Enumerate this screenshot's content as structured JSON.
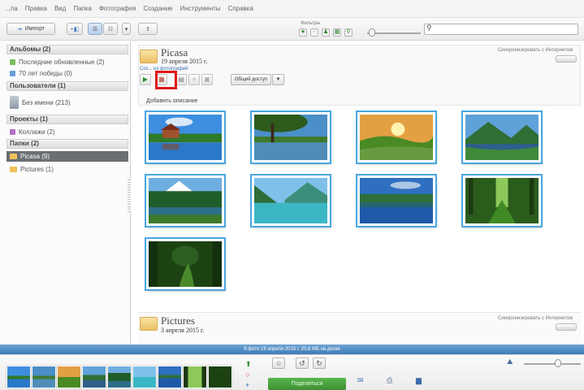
{
  "menu": [
    "...ла",
    "Правка",
    "Вид",
    "Папка",
    "Фотография",
    "Создание",
    "Инструменты",
    "Справка"
  ],
  "toolbar": {
    "import_label": "Импорт",
    "filters_label": "Фильтры"
  },
  "sidebar": {
    "albums": {
      "header": "Альбомы (2)",
      "items": [
        "Последние обновленные (2)",
        "70 лет победы (0)"
      ]
    },
    "users": {
      "header": "Пользователи (1)",
      "items": [
        "Без имени (213)"
      ]
    },
    "projects": {
      "header": "Проекты (1)",
      "items": [
        "Коллажи (2)"
      ]
    },
    "folders": {
      "header": "Папки (2)",
      "items": [
        "Picasa (9)",
        "Pictures (1)"
      ]
    }
  },
  "album": {
    "title": "Picasa",
    "date": "19 апреля 2015 г.",
    "link": "Соз... из фотографий",
    "sync_label": "Синхронизировать с Интернетом",
    "share_label": "Общий доступ",
    "add_description": "Добавить описание"
  },
  "pictures_album": {
    "title": "Pictures",
    "date": "3 апреля 2015 г.",
    "sync_label": "Синхронизировать с Интернетом"
  },
  "status": "9 фото   19 апреля 2015 г.   20,8 МБ на диске",
  "tray": {
    "share_button": "Поделиться"
  },
  "colors": {
    "selection": "#6a6f74",
    "thumb_border": "#49a6e0",
    "highlight": "#e01818",
    "status_bar": "#4a86bf",
    "share_green": "#4aa63f"
  },
  "photos": [
    {
      "name": "house-by-lake",
      "sky": "#3d8ee0",
      "ground": "#2f7a2a",
      "water": "#2a78c9"
    },
    {
      "name": "tree-over-lake",
      "sky": "#4a8fc7",
      "ground": "#3f7a2c",
      "water": "#4f8db8"
    },
    {
      "name": "golden-hills",
      "sky": "#e3a043",
      "ground": "#4a8a24",
      "water": "#6a9a40"
    },
    {
      "name": "mountain-lake",
      "sky": "#5fa1d9",
      "ground": "#2f6e35",
      "water": "#2e5f8a"
    },
    {
      "name": "snow-peak-forest",
      "sky": "#6faee0",
      "ground": "#1f5e2a",
      "water": "#2c6d8a"
    },
    {
      "name": "turquoise-lake",
      "sky": "#7ec0e8",
      "ground": "#3b8f7a",
      "water": "#3bb6c4"
    },
    {
      "name": "blue-lake-reflection",
      "sky": "#2f6fbf",
      "ground": "#2e6f3a",
      "water": "#1e5aa8"
    },
    {
      "name": "forest-path",
      "sky": "#8cc85a",
      "ground": "#2a5c1c",
      "water": "#3f8a25"
    },
    {
      "name": "green-tunnel",
      "sky": "#2c5e22",
      "ground": "#1c4212",
      "water": "#4a8a2c"
    }
  ]
}
